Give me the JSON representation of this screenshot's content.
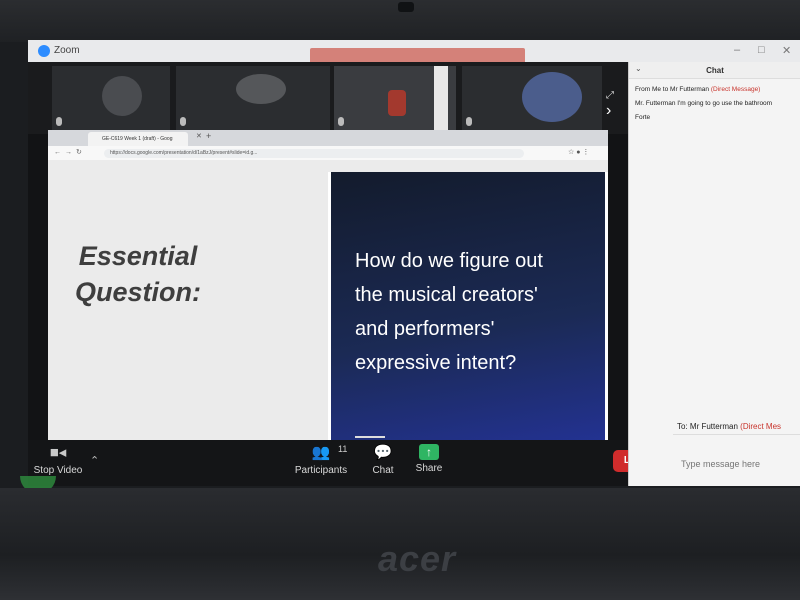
{
  "window": {
    "app_title": "Zoom"
  },
  "browser": {
    "tab_title": "GE-C619 Week 1 (draft) - Goog",
    "url": "https://docs.google.com/presentation/d/1aBzJ/present#slide=id.g..."
  },
  "slide": {
    "heading_line1": "Essential",
    "heading_line2": "Question:",
    "question_lines": [
      "How do we figure out",
      "the musical creators'",
      "and performers'",
      "expressive intent?"
    ]
  },
  "toolbar": {
    "stop_video": "Stop Video",
    "participants": "Participants",
    "participant_count": "11",
    "chat": "Chat",
    "share": "Share",
    "leave": "Leave"
  },
  "chat": {
    "title": "Chat",
    "messages": [
      {
        "header": "From Me to Mr Futterman",
        "tag": "(Direct Message)"
      },
      {
        "text": "Mr. Futterman I'm going to go use the bathroom"
      },
      {
        "text": "Forte"
      }
    ],
    "to_label": "To:",
    "recipient": "Mr Futterman",
    "recipient_tag": "(Direct Mes",
    "input_placeholder": "Type message here"
  },
  "device": {
    "brand": "acer"
  },
  "icons": {
    "video": "video-camera-icon",
    "participants": "participants-icon",
    "chat": "chat-bubble-icon",
    "share": "share-screen-icon",
    "expand": "chevron-right-icon",
    "caret": "chevron-up-icon"
  },
  "colors": {
    "leave": "#d02c2c",
    "share": "#2fb563",
    "dm": "#c8332b",
    "zoom": "#2d8cff"
  }
}
